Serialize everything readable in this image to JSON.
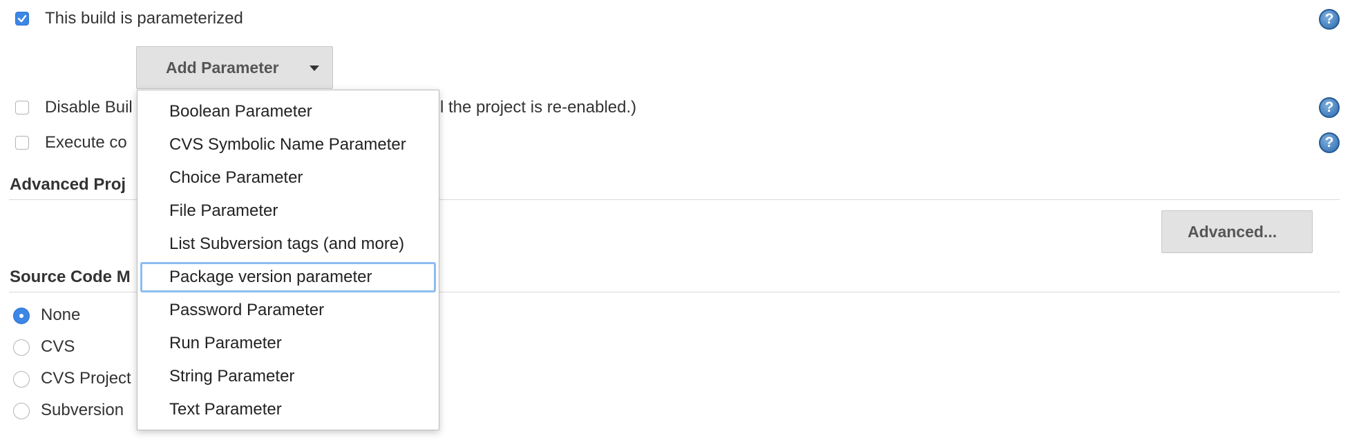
{
  "general": {
    "parameterized_label": "This build is parameterized",
    "parameterized_checked": true,
    "disable_label": "Disable Buil",
    "disable_suffix": "l the project is re-enabled.)",
    "execute_label": "Execute co"
  },
  "add_parameter": {
    "label": "Add Parameter",
    "menu_items": [
      "Boolean Parameter",
      "CVS Symbolic Name Parameter",
      "Choice Parameter",
      "File Parameter",
      "List Subversion tags (and more)",
      "Package version parameter",
      "Password Parameter",
      "Run Parameter",
      "String Parameter",
      "Text Parameter"
    ],
    "focused_item": "Package version parameter"
  },
  "advanced_project": {
    "title": "Advanced Proj",
    "advanced_button": "Advanced..."
  },
  "scm": {
    "title": "Source Code M",
    "options": [
      "None",
      "CVS",
      "CVS Project",
      "Subversion"
    ],
    "selected": "None"
  },
  "help_icon_glyph": "?",
  "colors": {
    "accent": "#3b86e6",
    "focus_ring": "#8cbcf0",
    "button_bg": "#e2e2e2",
    "help_icon": "#2c6aab"
  }
}
